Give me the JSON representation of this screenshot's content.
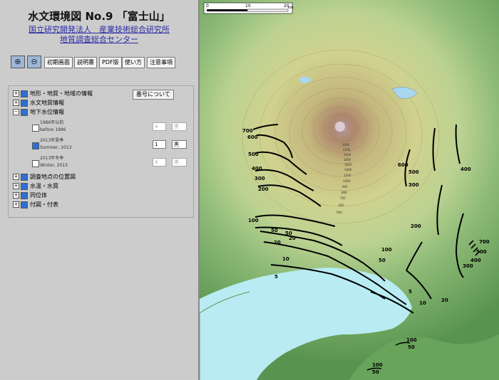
{
  "header": {
    "title": "水文環境図 No.9 「富士山」",
    "org1": "国立研究開発法人　産業技術総合研究所",
    "org2": "地質調査総合センター"
  },
  "toolbar": {
    "zoom_in_icon": "zoom-in-icon",
    "zoom_out_icon": "zoom-out-icon",
    "buttons": [
      "初期画面",
      "説明書",
      "PDF版",
      "使い方",
      "注意事項"
    ]
  },
  "layers": {
    "about_button": "番号について",
    "items": [
      {
        "label": "地形・地質・地域の情報"
      },
      {
        "label": "水文地質情報"
      },
      {
        "label": "地下水位情報"
      },
      {
        "label": "調査地点の位置図"
      },
      {
        "label": "水温・水質"
      },
      {
        "label": "同位体"
      },
      {
        "label": "付図・付表"
      }
    ],
    "sub": [
      {
        "label": "1986年以前",
        "sub": "before 1986",
        "num": "4",
        "color": "黒"
      },
      {
        "label": "2013年夏季",
        "sub": "Summer, 2013",
        "num": "1",
        "color": "黒"
      },
      {
        "label": "2013年冬季",
        "sub": "Winter, 2013",
        "num": "4",
        "color": "黒"
      }
    ]
  },
  "scale": {
    "labels": [
      "0",
      "10",
      "20"
    ],
    "unit": "km"
  },
  "contours": {
    "labels_left": [
      "700",
      "600",
      "500",
      "400",
      "300",
      "200",
      "100",
      "50",
      "50",
      "20",
      "20",
      "10",
      "5"
    ],
    "labels_right": [
      "600",
      "500",
      "400",
      "300",
      "200",
      "100",
      "50",
      "5",
      "10",
      "20",
      "300",
      "400",
      "500",
      "700"
    ],
    "labels_center": [
      "2400",
      "2200",
      "2000",
      "1800",
      "1600",
      "1400",
      "1200",
      "1000",
      "900",
      "800",
      "700",
      "600",
      "500"
    ],
    "labels_bottom": [
      "100",
      "50",
      "100",
      "50"
    ]
  },
  "colors": {
    "panel": "#cfcfcf",
    "link": "#2a2aa6",
    "sea": "#b8ecf2",
    "lowland": "#7fb46a",
    "midland": "#d8e4a0",
    "summit": "#b08aa0"
  }
}
